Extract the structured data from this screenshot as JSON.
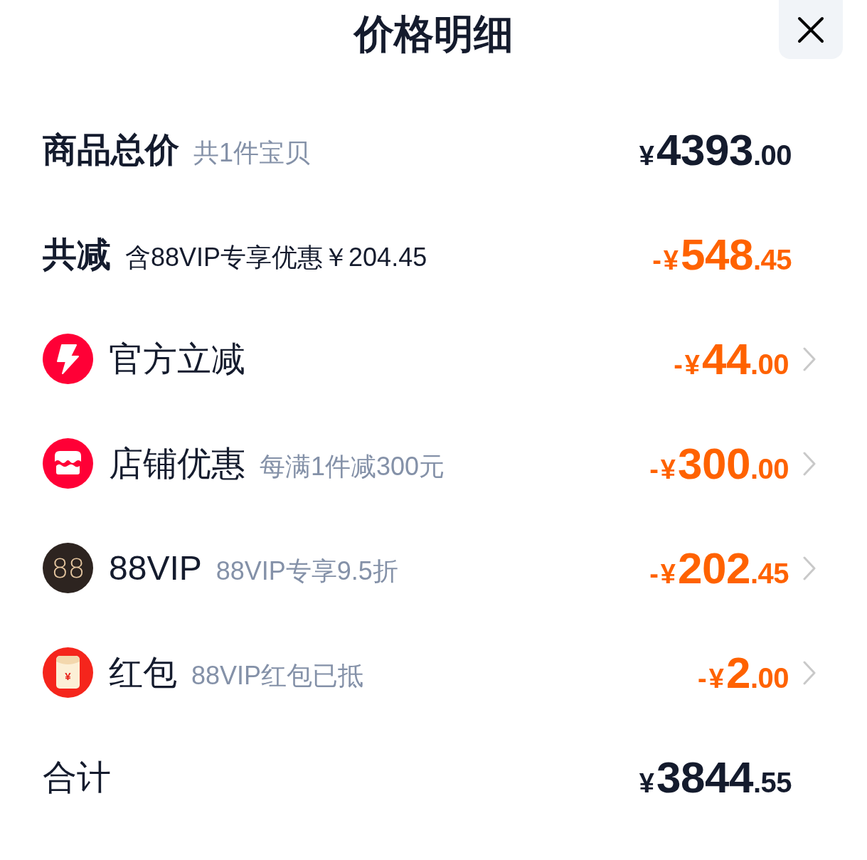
{
  "header": {
    "title": "价格明细"
  },
  "rows": [
    {
      "kind": "subtotal",
      "label": "商品总价",
      "note": "共1件宝贝",
      "amount": "¥4393.00"
    },
    {
      "kind": "savings",
      "label": "共减",
      "note": "含88VIP专享优惠￥204.45",
      "amount": "-¥548.45"
    },
    {
      "kind": "instant",
      "label": "官方立减",
      "amount": "-¥44.00"
    },
    {
      "kind": "store",
      "label": "店铺优惠",
      "note": "每满1件减300元",
      "amount": "-¥300.00"
    },
    {
      "kind": "vip",
      "logo_text": "88",
      "label": "88VIP",
      "note": "88VIP专享9.5折",
      "amount": "-¥202.45"
    },
    {
      "kind": "redpacket",
      "logo_text": "¥",
      "label": "红包",
      "note": "88VIP红包已抵",
      "amount": "-¥2.00"
    },
    {
      "kind": "total",
      "label": "合计",
      "amount": "¥3844.55"
    }
  ]
}
